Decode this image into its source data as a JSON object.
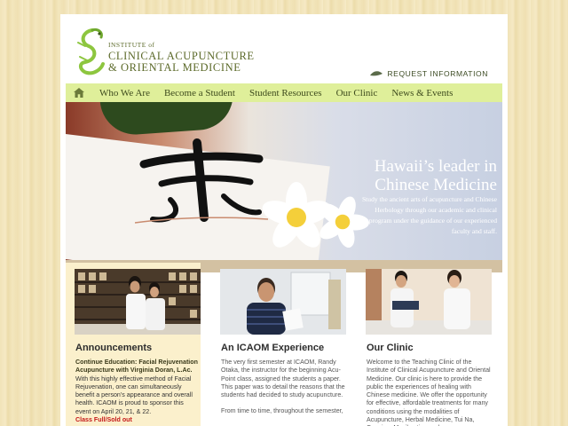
{
  "logo": {
    "line1": "INSTITUTE of",
    "line2": "CLINICAL ACUPUNCTURE",
    "line3": "& ORIENTAL MEDICINE"
  },
  "header": {
    "request_info": "REQUEST INFORMATION"
  },
  "nav": {
    "home_icon": "home-icon",
    "items": [
      "Who We Are",
      "Become a Student",
      "Student Resources",
      "Our Clinic",
      "News & Events"
    ]
  },
  "hero": {
    "title": "Hawaii’s leader in Chinese Medicine",
    "description": "Study the ancient arts of acupuncture and Chinese Herbology through our academic and clinical program under the guidance of our experienced faculty and staff."
  },
  "columns": [
    {
      "heading": "Announcements",
      "subheading": "Continue Education: Facial Rejuvenation Acupuncture with Virginia Doran, L.Ac.",
      "body": "With this highly effective method of Facial Rejuvenation, one can simultaneously benefit a person's appearance and overall health. ICAOM is proud to sponsor this event on April 20, 21, & 22.",
      "status": "Class Full/Sold out"
    },
    {
      "heading": "An ICAOM Experience",
      "paragraphs": [
        "The very first semester at ICAOM, Randy Otaka, the instructor for the beginning Acu-Point class, assigned the students a paper.  This paper was to detail the reasons that the students had decided to study acupuncture.",
        "From time to time, throughout the semester,"
      ]
    },
    {
      "heading": "Our Clinic",
      "paragraphs": [
        "Welcome to the Teaching Clinic of the Institute of Clinical Acupuncture and Oriental Medicine. Our clinic is here to provide the public the experiences of healing with Chinese medicine. We offer the opportunity for effective, affordable treatments for many conditions using the modalities of Acupuncture, Herbal Medicine, Tui Na, Cupping, Moxibustion and"
      ]
    }
  ],
  "colors": {
    "nav_bg": "#dfef9a",
    "logo_green": "#8dc63f",
    "status_red": "#c41818",
    "announcement_bg": "#fbf0cc"
  }
}
